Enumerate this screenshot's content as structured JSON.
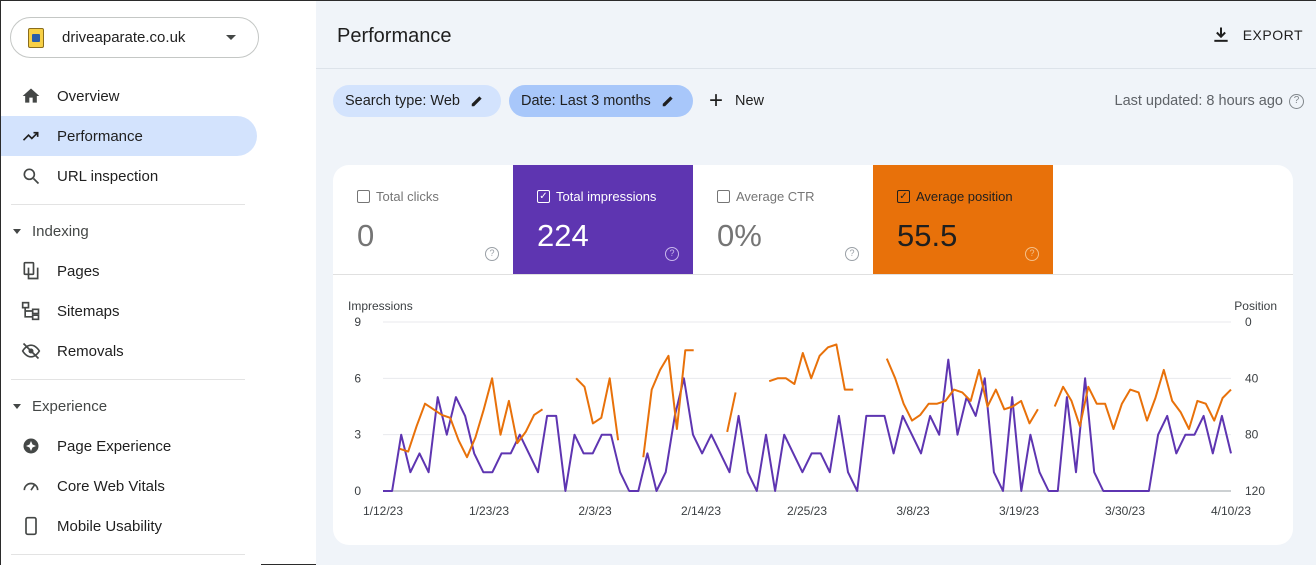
{
  "property": {
    "name": "driveaparate.co.uk"
  },
  "sidebar": {
    "top_items": [
      {
        "label": "Overview",
        "icon": "home-icon"
      },
      {
        "label": "Performance",
        "icon": "trending-up-icon",
        "active": true
      },
      {
        "label": "URL inspection",
        "icon": "search-icon"
      }
    ],
    "sections": [
      {
        "label": "Indexing",
        "items": [
          {
            "label": "Pages",
            "icon": "pages-icon"
          },
          {
            "label": "Sitemaps",
            "icon": "sitemap-icon"
          },
          {
            "label": "Removals",
            "icon": "eye-off-icon"
          }
        ]
      },
      {
        "label": "Experience",
        "items": [
          {
            "label": "Page Experience",
            "icon": "page-experience-icon"
          },
          {
            "label": "Core Web Vitals",
            "icon": "gauge-icon"
          },
          {
            "label": "Mobile Usability",
            "icon": "phone-icon"
          }
        ]
      }
    ]
  },
  "header": {
    "title": "Performance",
    "export_label": "EXPORT"
  },
  "filters": {
    "search_type": "Search type: Web",
    "date": "Date: Last 3 months",
    "new_label": "New",
    "last_updated": "Last updated: 8 hours ago"
  },
  "metrics": {
    "clicks": {
      "label": "Total clicks",
      "value": "0",
      "checked": false
    },
    "impressions": {
      "label": "Total impressions",
      "value": "224",
      "checked": true
    },
    "ctr": {
      "label": "Average CTR",
      "value": "0%",
      "checked": false
    },
    "position": {
      "label": "Average position",
      "value": "55.5",
      "checked": true
    }
  },
  "colors": {
    "impressions": "#5e35b1",
    "position": "#e8710a",
    "active_nav": "#d3e3fd"
  },
  "chart_data": {
    "type": "line",
    "left_axis_title": "Impressions",
    "right_axis_title": "Position",
    "left_ylim": [
      0,
      9
    ],
    "left_ticks": [
      "0",
      "3",
      "6",
      "9"
    ],
    "right_ylim": [
      0,
      120
    ],
    "right_inverted": true,
    "right_ticks": [
      "0",
      "40",
      "80",
      "120"
    ],
    "x_tick_labels": [
      "1/12/23",
      "1/23/23",
      "2/3/23",
      "2/14/23",
      "2/25/23",
      "3/8/23",
      "3/19/23",
      "3/30/23",
      "4/10/23"
    ],
    "x_tick_days": [
      0,
      11,
      22,
      33,
      44,
      55,
      66,
      77,
      88
    ],
    "x_days": 89,
    "series": [
      {
        "name": "Impressions",
        "axis": "left",
        "values": [
          0,
          0,
          3,
          1,
          2,
          1,
          5,
          3,
          5,
          4,
          2,
          1,
          1,
          2,
          2,
          3,
          2,
          1,
          4,
          4,
          0,
          3,
          2,
          2,
          3,
          3,
          1,
          0,
          0,
          2,
          0,
          1,
          4,
          6,
          3,
          2,
          3,
          2,
          1,
          4,
          1,
          0,
          3,
          0,
          3,
          2,
          1,
          2,
          2,
          1,
          4,
          1,
          0,
          4,
          4,
          4,
          2,
          4,
          3,
          2,
          4,
          3,
          7,
          3,
          5,
          4,
          6,
          1,
          0,
          5,
          0,
          3,
          1,
          0,
          0,
          5,
          1,
          6,
          1,
          0,
          0,
          0,
          0,
          0,
          0,
          3,
          4,
          2,
          3,
          3,
          4,
          2,
          4,
          2
        ]
      },
      {
        "name": "Position",
        "axis": "right",
        "values": [
          null,
          null,
          90,
          92,
          74,
          58,
          62,
          66,
          68,
          84,
          96,
          82,
          62,
          40,
          80,
          56,
          86,
          78,
          66,
          62,
          null,
          null,
          null,
          40,
          46,
          72,
          68,
          40,
          84,
          null,
          null,
          96,
          48,
          34,
          24,
          76,
          20,
          20,
          null,
          null,
          null,
          78,
          50,
          null,
          null,
          null,
          42,
          40,
          40,
          44,
          22,
          40,
          24,
          18,
          16,
          48,
          48,
          null,
          null,
          null,
          26,
          40,
          58,
          70,
          66,
          58,
          58,
          56,
          48,
          50,
          56,
          34,
          60,
          48,
          62,
          60,
          56,
          72,
          62,
          null,
          60,
          46,
          56,
          74,
          46,
          58,
          58,
          76,
          58,
          48,
          50,
          70,
          54,
          34,
          56,
          64,
          76,
          56,
          58,
          70,
          54,
          48
        ]
      }
    ]
  }
}
